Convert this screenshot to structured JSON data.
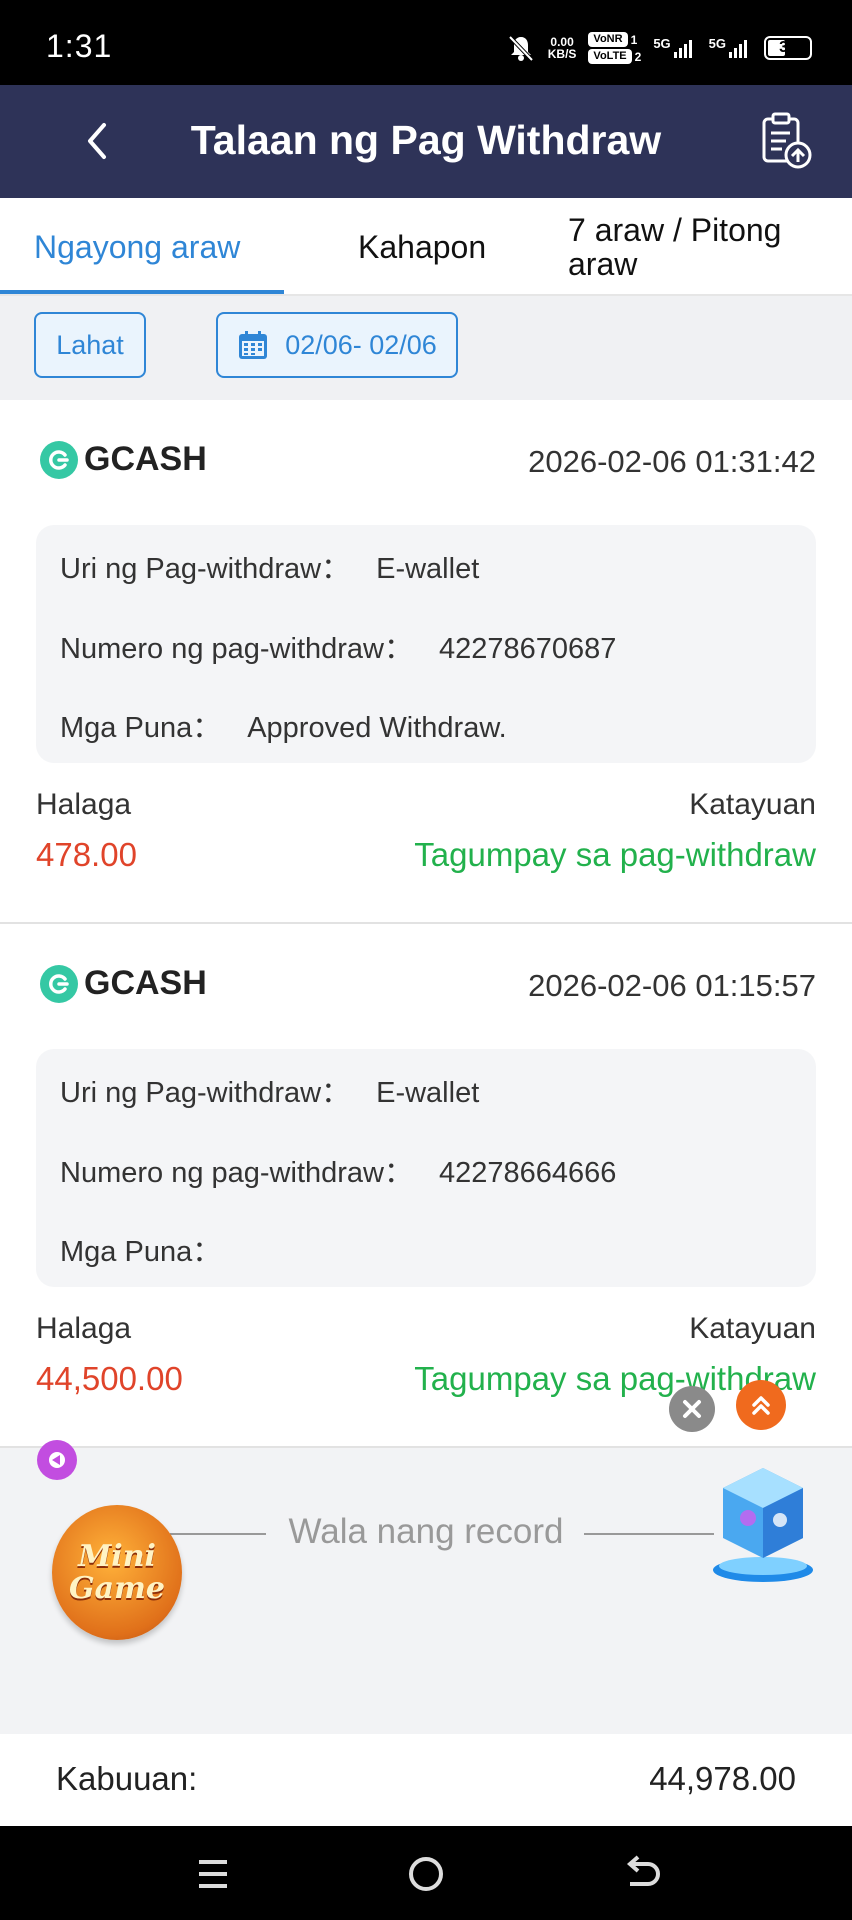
{
  "status_bar": {
    "time": "1:31",
    "net_speed_top": "0.00",
    "net_speed_bottom": "KB/S",
    "volte_top": "VoNR",
    "volte_bottom": "VoLTE",
    "sim1": "1",
    "sim2": "2",
    "net1": "5G",
    "net2": "5G",
    "battery": "39"
  },
  "header": {
    "title": "Talaan ng Pag Withdraw"
  },
  "tabs": [
    {
      "label": "Ngayong araw",
      "active": true
    },
    {
      "label": "Kahapon",
      "active": false
    },
    {
      "label": "7 araw / Pitong araw",
      "active": false
    }
  ],
  "filters": {
    "all_label": "Lahat",
    "date_range": "02/06- 02/06"
  },
  "records": [
    {
      "provider": "GCASH",
      "datetime": "2026-02-06 01:31:42",
      "type_label": "Uri ng Pag-withdraw：",
      "type_value": "E-wallet",
      "number_label": "Numero ng pag-withdraw：",
      "number_value": "42278670687",
      "remarks_label": "Mga Puna：",
      "remarks_value": "Approved Withdraw.",
      "amount_label": "Halaga",
      "amount": "478.00",
      "status_label": "Katayuan",
      "status": "Tagumpay sa pag-withdraw"
    },
    {
      "provider": "GCASH",
      "datetime": "2026-02-06 01:15:57",
      "type_label": "Uri ng Pag-withdraw：",
      "type_value": "E-wallet",
      "number_label": "Numero ng pag-withdraw：",
      "number_value": "42278664666",
      "remarks_label": "Mga Puna：",
      "remarks_value": "",
      "amount_label": "Halaga",
      "amount": "44,500.00",
      "status_label": "Katayuan",
      "status": "Tagumpay sa pag-withdraw"
    }
  ],
  "no_more_text": "Wala nang record",
  "total": {
    "label": "Kabuuan:",
    "value": "44,978.00"
  },
  "floating": {
    "minigame_line1": "Mini",
    "minigame_line2": "Game"
  },
  "colors": {
    "header_bg": "#2e3358",
    "accent_blue": "#2f86d6",
    "amount_red": "#e0442a",
    "success_green": "#22b14c",
    "gcash_teal": "#35c8a4"
  }
}
